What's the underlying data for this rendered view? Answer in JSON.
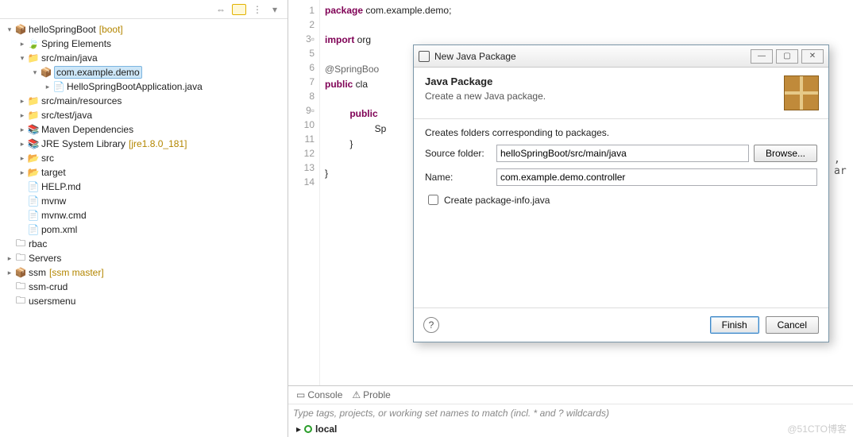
{
  "tree": {
    "root": "helloSpringBoot",
    "root_decor": "[boot]",
    "items": [
      "Spring Elements",
      "src/main/java",
      "com.example.demo",
      "HelloSpringBootApplication.java",
      "src/main/resources",
      "src/test/java",
      "Maven Dependencies",
      "JRE System Library",
      "src",
      "target",
      "HELP.md",
      "mvnw",
      "mvnw.cmd",
      "pom.xml"
    ],
    "jre_decor": "[jre1.8.0_181]",
    "roots2": [
      "rbac",
      "Servers"
    ],
    "ssm": "ssm",
    "ssm_decor": "[ssm master]",
    "roots3": [
      "ssm-crud",
      "usersmenu"
    ]
  },
  "code": {
    "line1_kw": "package",
    "line1_rest": " com.example.demo;",
    "line3_kw": "import",
    "line3_rest": " org",
    "line6": "@SpringBoo",
    "line7_kw": "public",
    "line7_rest": " cla",
    "line9_kw": "public",
    "line10": "S",
    "line10_tail": "p",
    "line11": "}",
    "line13": "}",
    "overhang": ", ar"
  },
  "dialog": {
    "title": "New Java Package",
    "heading": "Java Package",
    "sub": "Create a new Java package.",
    "desc": "Creates folders corresponding to packages.",
    "source_label": "Source folder:",
    "source_value": "helloSpringBoot/src/main/java",
    "browse": "Browse...",
    "name_label": "Name:",
    "name_value": "com.example.demo.controller",
    "checkbox": "Create package-info.java",
    "finish": "Finish",
    "cancel": "Cancel"
  },
  "bottom": {
    "console": "Console",
    "problems": "Proble",
    "filter_placeholder": "Type tags, projects, or working set names to match (incl. * and ? wildcards)",
    "local": "local"
  },
  "watermark": "@51CTO博客"
}
